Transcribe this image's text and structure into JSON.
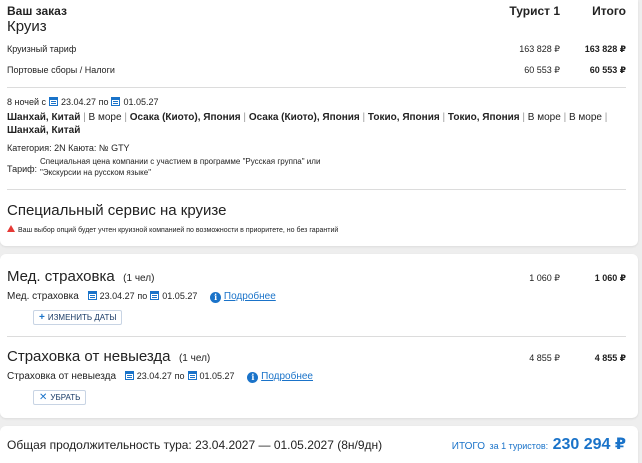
{
  "order": {
    "header": "Ваш заказ",
    "subheader": "Круиз",
    "col_tourist": "Турист 1",
    "col_total": "Итого",
    "rows": [
      {
        "label": "Круизный тариф",
        "tourist": "163 828 ₽",
        "total": "163 828 ₽"
      },
      {
        "label": "Портовые сборы / Налоги",
        "tourist": "60 553 ₽",
        "total": "60 553 ₽"
      }
    ],
    "nights": "8 ночей с",
    "date_from": "23.04.27",
    "date_to_word": "по",
    "date_to": "01.05.27",
    "route_line1": [
      "Шанхай, Китай",
      "В море",
      "Осака (Киото), Япония",
      "Осака (Киото), Япония",
      "Токио, Япония",
      "Токио, Япония",
      "В море",
      "В море"
    ],
    "route_line2": "Шанхай, Китай",
    "category": "Категория: 2N   Каюта: № GTY",
    "tariff_label": "Тариф:",
    "tariff_line1": "Специальная цена компании с участием в программе \"Русская группа\" или",
    "tariff_line2": "\"Экскурсии на русском языке\"",
    "special_title": "Специальный сервис на круизе",
    "special_note": "Ваш выбор опций будет учтен круизной компанией по возможности в приоритете, но без гарантий"
  },
  "insurance": [
    {
      "title": "Мед. страховка",
      "persons": "(1 чел)",
      "tourist": "1 060 ₽",
      "total": "1 060 ₽",
      "sub_label": "Мед. страховка",
      "date_from": "23.04.27",
      "date_to_word": "по",
      "date_to": "01.05.27",
      "link": "Подробнее",
      "button": "Изменить даты"
    },
    {
      "title": "Страховка от невыезда",
      "persons": "(1 чел)",
      "tourist": "4 855 ₽",
      "total": "4 855 ₽",
      "sub_label": "Страховка от невыезда",
      "date_from": "23.04.27",
      "date_to_word": "по",
      "date_to": "01.05.27",
      "link": "Подробнее",
      "button": "Убрать"
    }
  ],
  "footer": {
    "duration": "Общая продолжительность тура: 23.04.2027 — 01.05.2027 (8н/9дн)",
    "total_label": "ИТОГО",
    "total_for": "за 1 туристов:",
    "total_value": "230 294 ₽"
  },
  "colors": {
    "accent": "#1a73c9",
    "warning": "#e53935"
  }
}
